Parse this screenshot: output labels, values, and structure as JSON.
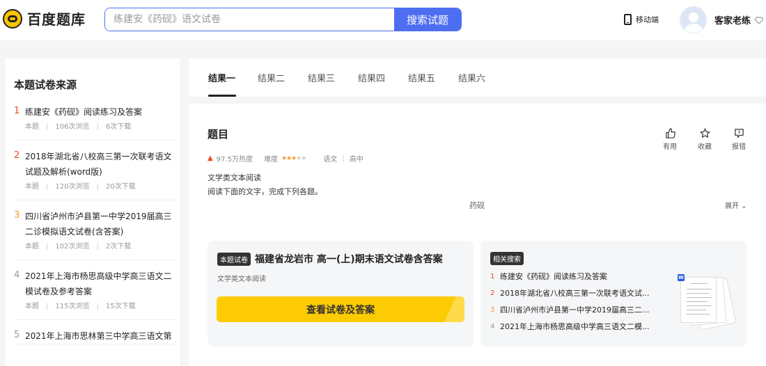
{
  "header": {
    "logo_text": "百度题库",
    "search_placeholder": "练建安《药砚》语文试卷",
    "search_button": "搜索试题",
    "mobile_label": "移动端",
    "user_name": "客家老练"
  },
  "sidebar": {
    "title": "本题试卷来源",
    "items": [
      {
        "num": "1",
        "color": "#f04a1a",
        "title": "练建安《药砚》阅读练习及答案",
        "type": "本题",
        "views": "106次浏览",
        "downloads": "6次下载"
      },
      {
        "num": "2",
        "color": "#f04a1a",
        "title": "2018年湖北省八校高三第一次联考语文试题及解析(word版)",
        "type": "本题",
        "views": "120次浏览",
        "downloads": "20次下载"
      },
      {
        "num": "3",
        "color": "#f59a23",
        "title": "四川省泸州市泸县第一中学2019届高三二诊模拟语文试卷(含答案)",
        "type": "本题",
        "views": "102次浏览",
        "downloads": "2次下载"
      },
      {
        "num": "4",
        "color": "#999999",
        "title": "2021年上海市杨思高级中学高三语文二模试卷及参考答案",
        "type": "本题",
        "views": "115次浏览",
        "downloads": "15次下载"
      },
      {
        "num": "5",
        "color": "#999999",
        "title": "2021年上海市思林第三中学高三语文第",
        "type": "",
        "views": "",
        "downloads": ""
      }
    ]
  },
  "tabs": [
    "结果一",
    "结果二",
    "结果三",
    "结果四",
    "结果五",
    "结果六"
  ],
  "question": {
    "title": "题目",
    "actions": {
      "useful": "有用",
      "favorite": "收藏",
      "report": "报错"
    },
    "heat": "97.5万热度",
    "difficulty_label": "难度",
    "difficulty_stars": 3,
    "subject": "语文",
    "grade": "高中",
    "line1": "文学类文本阅读",
    "line2": "阅读下面的文字，完成下列各题。",
    "center_title": "药砚",
    "expand_label": "展开"
  },
  "paper": {
    "badge": "本题试卷",
    "name": "福建省龙岩市 高一(上)期末语文试卷含答案",
    "subtitle": "文学类文本阅读",
    "button": "查看试卷及答案"
  },
  "related": {
    "badge": "相关搜索",
    "items": [
      {
        "num": "1",
        "color": "#f04a1a",
        "text": "练建安《药砚》阅读练习及答案"
      },
      {
        "num": "2",
        "color": "#f04a1a",
        "text": "2018年湖北省八校高三第一次联考语文试..."
      },
      {
        "num": "3",
        "color": "#f59a23",
        "text": "四川省泸州市泸县第一中学2019届高三二..."
      },
      {
        "num": "4",
        "color": "#999999",
        "text": "2021年上海市杨思高级中学高三语文二模..."
      }
    ]
  },
  "colors": {
    "brand_blue": "#4e6ef2",
    "cta_yellow": "#fdcb03",
    "hot_red": "#f04a1a",
    "warm_orange": "#f59a23"
  }
}
